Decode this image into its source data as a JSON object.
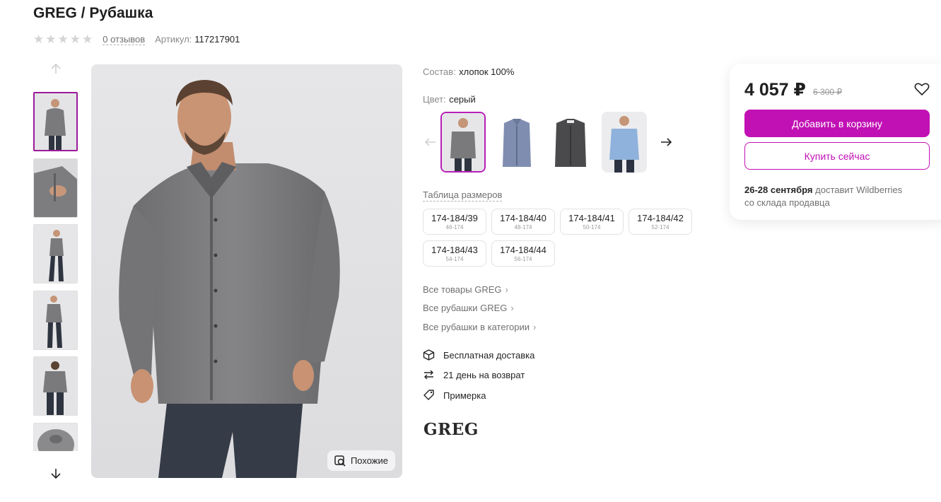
{
  "product": {
    "title": "GREG / Рубашка",
    "reviews": "0 отзывов",
    "article_label": "Артикул:",
    "article_value": "117217901",
    "rating_stars": 0
  },
  "gallery": {
    "similar_label": "Похожие"
  },
  "details": {
    "composition_label": "Состав:",
    "composition_value": "хлопок 100%",
    "color_label": "Цвет:",
    "color_value": "серый"
  },
  "sizes": {
    "title": "Таблица размеров",
    "items": [
      {
        "size": "174-184/39",
        "ru": "46-174"
      },
      {
        "size": "174-184/40",
        "ru": "48-174"
      },
      {
        "size": "174-184/41",
        "ru": "50-174"
      },
      {
        "size": "174-184/42",
        "ru": "52-174"
      },
      {
        "size": "174-184/43",
        "ru": "54-174"
      },
      {
        "size": "174-184/44",
        "ru": "56-174"
      }
    ]
  },
  "links": [
    "Все товары GREG",
    "Все рубашки GREG",
    "Все рубашки в категории"
  ],
  "features": [
    {
      "label": "Бесплатная доставка",
      "icon": "box-icon"
    },
    {
      "label": "21 день на возврат",
      "icon": "return-arrows-icon"
    },
    {
      "label": "Примерка",
      "icon": "tag-icon"
    }
  ],
  "brand_logo": "GREG",
  "buy": {
    "price": "4 057 ₽",
    "old_price": "6 300 ₽",
    "add_to_cart": "Добавить в корзину",
    "buy_now": "Купить сейчас",
    "delivery_date": "26-28 сентября",
    "delivery_text": "доставит Wildberries",
    "delivery_from": "со склада продавца"
  },
  "colors": {
    "accent": "#c110b4",
    "selected_border": "#9c1a9c"
  }
}
